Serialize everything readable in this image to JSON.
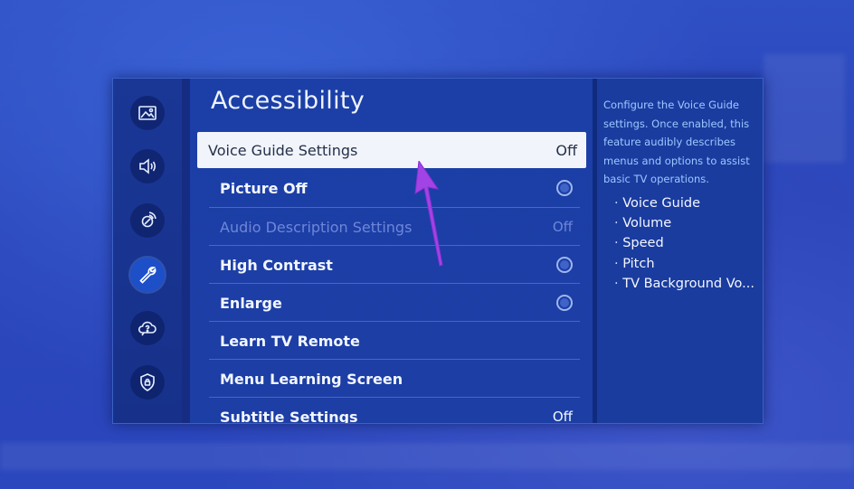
{
  "menu": {
    "title": "Accessibility",
    "items": [
      {
        "label": "Voice Guide Settings",
        "value": "Off",
        "selected": true
      },
      {
        "label": "Picture Off",
        "control": "radio"
      },
      {
        "label": "Audio Description Settings",
        "value": "Off",
        "disabled": true
      },
      {
        "label": "High Contrast",
        "control": "radio"
      },
      {
        "label": "Enlarge",
        "control": "radio"
      },
      {
        "label": "Learn TV Remote"
      },
      {
        "label": "Menu Learning Screen"
      },
      {
        "label": "Subtitle Settings",
        "value": "Off"
      }
    ]
  },
  "sidebar": {
    "icons": [
      {
        "name": "picture-icon"
      },
      {
        "name": "sound-icon"
      },
      {
        "name": "broadcast-icon"
      },
      {
        "name": "wrench-icon",
        "active": true
      },
      {
        "name": "support-icon"
      },
      {
        "name": "privacy-shield-icon"
      }
    ]
  },
  "help": {
    "description": "Configure the Voice Guide settings. Once enabled, this feature audibly describes menus and options to assist basic TV operations.",
    "options": [
      "Voice Guide",
      "Volume",
      "Speed",
      "Pitch",
      "TV Background Vo..."
    ]
  },
  "colors": {
    "panel_bg": "#1b3fa6",
    "selected_row_bg": "#f1f4fb",
    "help_text": "#9cc8ff",
    "pointer_arrow": "#a243e6"
  }
}
